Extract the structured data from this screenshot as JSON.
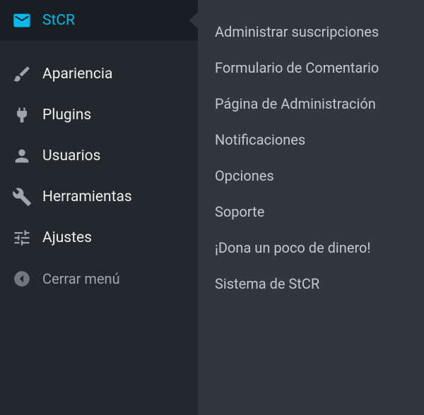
{
  "sidebar": {
    "items": [
      {
        "label": "StCR"
      },
      {
        "label": "Apariencia"
      },
      {
        "label": "Plugins"
      },
      {
        "label": "Usuarios"
      },
      {
        "label": "Herramientas"
      },
      {
        "label": "Ajustes"
      }
    ],
    "collapse_label": "Cerrar menú"
  },
  "submenu": {
    "items": [
      {
        "label": "Administrar suscripciones"
      },
      {
        "label": "Formulario de Comentario"
      },
      {
        "label": "Página de Administración"
      },
      {
        "label": "Notificaciones"
      },
      {
        "label": "Opciones"
      },
      {
        "label": "Soporte"
      },
      {
        "label": "¡Dona un poco de dinero!"
      },
      {
        "label": "Sistema de StCR"
      }
    ]
  }
}
